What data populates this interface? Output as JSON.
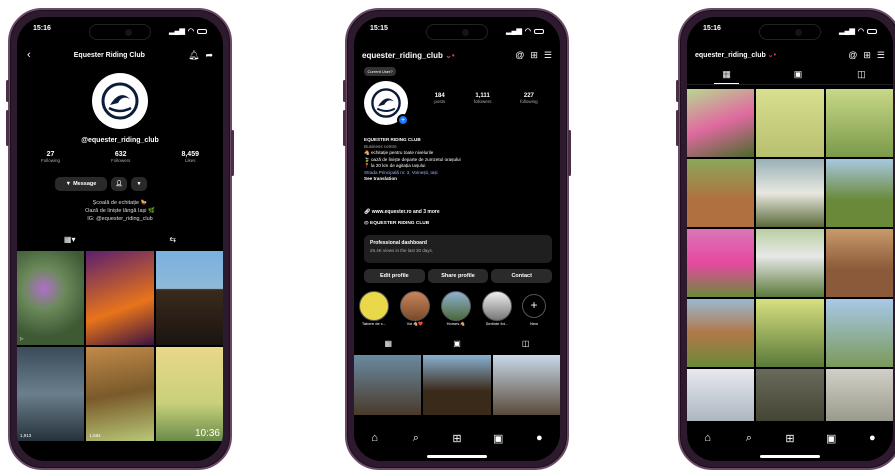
{
  "phone1": {
    "time": "15:16",
    "header_title": "Equester Riding Club",
    "username": "@equester_riding_club",
    "stats": [
      {
        "value": "27",
        "label": "Following"
      },
      {
        "value": "632",
        "label": "Followers"
      },
      {
        "value": "8,459",
        "label": "Likes"
      }
    ],
    "message_label": "Message",
    "bio": [
      "Școală de echitație 🐎",
      "Oază de liniște lângă Iași 🌿",
      "IG: @equester_riding_club"
    ],
    "grid_labels": {
      "views_a": "1,913",
      "views_b": "1,584",
      "clock": "10:36"
    }
  },
  "phone2": {
    "time": "15:15",
    "username": "equester_riding_club",
    "tooltip": "Current User?",
    "stats": [
      {
        "value": "184",
        "label": "posts"
      },
      {
        "value": "1,111",
        "label": "followers"
      },
      {
        "value": "227",
        "label": "following"
      }
    ],
    "name": "EQUESTER RIDING CLUB",
    "category": "Business centre",
    "bio_lines": [
      "🐴 echitație pentru toate nivelurile",
      "🍃 oază de liniște departe de zumzetul orașului",
      "📍 la 20 km de agitația Iașului"
    ],
    "address": "Strada Principală nr. 3, Voinești, Iași",
    "see_translation": "See translation",
    "link": "www.equester.ro and 3 more",
    "threads": "EQUESTER RIDING CLUB",
    "dashboard_title": "Professional dashboard",
    "dashboard_sub": "25.4K views in the last 30 days.",
    "buttons": [
      "Edit profile",
      "Share profile",
      "Contact"
    ],
    "highlights": [
      "Tabere de c...",
      "Voi 🐴❤️",
      "Horses 🐴",
      "Ședințe fot...",
      "New"
    ]
  },
  "phone3": {
    "time": "15:16",
    "username": "equester_riding_club"
  },
  "colors": {
    "accent": "#e1306c",
    "bg": "#000000",
    "frame": "#2e1a2e",
    "link": "#9bb6ff"
  }
}
